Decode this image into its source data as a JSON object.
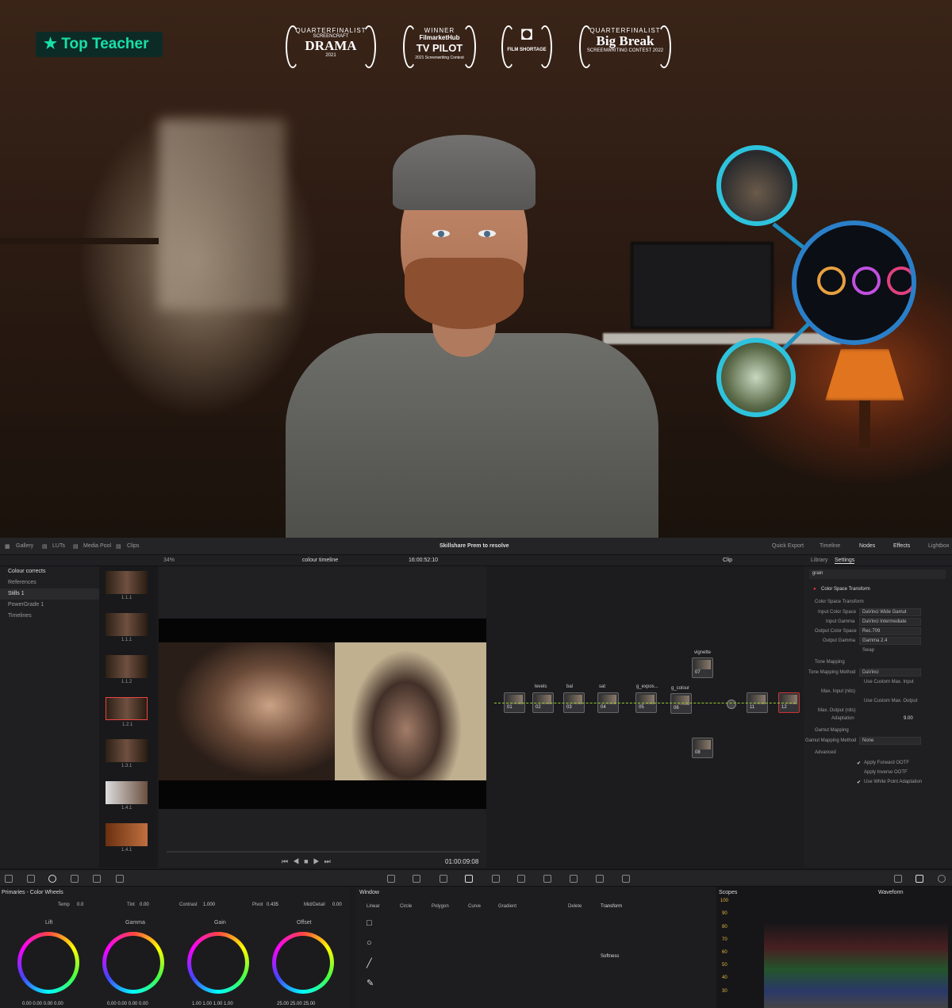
{
  "hero": {
    "badge": "★ Top Teacher",
    "laurels": [
      {
        "top": "QUARTERFINALIST",
        "mid": "SCREENCRAFT",
        "big": "DRAMA",
        "bottom": "2021"
      },
      {
        "top": "WINNER",
        "mid": "FilmarketHub",
        "big": "TV PILOT",
        "bottom": "2021 Screenwriting Contest"
      },
      {
        "top": "",
        "mid": "",
        "big": "◘",
        "bottom": "FILM SHORTAGE"
      },
      {
        "top": "QUARTERFINALIST",
        "mid": "",
        "big": "Big Break",
        "bottom": "SCREENWRITING CONTEST 2022"
      }
    ]
  },
  "topbar": {
    "gallery": "Gallery",
    "luts": "LUTs",
    "media_pool": "Media Pool",
    "clips": "Clips",
    "project": "Skillshare Prem to resolve",
    "quick_export": "Quick Export",
    "timeline": "Timeline",
    "nodes": "Nodes",
    "effects": "Effects",
    "lightbox": "Lightbox"
  },
  "subbar": {
    "zoom": "34%",
    "timeline_name": "colour timeline",
    "timecode": "16:00:52:10",
    "clip": "Clip",
    "library": "Library",
    "settings": "Settings"
  },
  "gallery": {
    "items": [
      "Colour corrects",
      "References",
      "Stills 1",
      "PowerGrade 1",
      "Timelines"
    ]
  },
  "thumbs": [
    "1.1.1",
    "1.1.1",
    "1.1.2",
    "1.2.1",
    "1.3.1",
    "1.4.1",
    "1.4.1"
  ],
  "viewer": {
    "timecode": "01:00:09:08"
  },
  "nodes": [
    {
      "num": "01",
      "label": ""
    },
    {
      "num": "02",
      "label": "levels"
    },
    {
      "num": "03",
      "label": "bal"
    },
    {
      "num": "04",
      "label": "sat"
    },
    {
      "num": "05",
      "label": "g_expos..."
    },
    {
      "num": "06",
      "label": "g_colour"
    },
    {
      "num": "07",
      "label": "vignette"
    },
    {
      "num": "08",
      "label": ""
    },
    {
      "num": "11",
      "label": ""
    },
    {
      "num": "12",
      "label": ""
    }
  ],
  "settings": {
    "search": "grain",
    "effect": "Color Space Transform",
    "section1": "Color Space Transform",
    "rows": [
      {
        "label": "Input Color Space",
        "value": "DaVinci Wide Gamut"
      },
      {
        "label": "Input Gamma",
        "value": "DaVinci Intermediate"
      },
      {
        "label": "Output Color Space",
        "value": "Rec.709"
      },
      {
        "label": "Output Gamma",
        "value": "Gamma 2.4"
      }
    ],
    "swap": "Swap",
    "tone_mapping": "Tone Mapping",
    "tone_method_label": "Tone Mapping Method",
    "tone_method": "DaVinci",
    "custom_max_input": "Use Custom Max. Input",
    "max_input": "Max. Input (nits)",
    "custom_max_output": "Use Custom Max. Output",
    "max_output": "Max. Output (nits)",
    "adaptation": "Adaptation",
    "adaptation_val": "9.00",
    "gamut_mapping": "Gamut Mapping",
    "gamut_method_label": "Gamut Mapping Method",
    "gamut_method": "None",
    "advanced": "Advanced",
    "apply_forward": "Apply Forward OOTF",
    "apply_inverse": "Apply Inverse OOTF",
    "white_point": "Use White Point Adaptation"
  },
  "wheels": {
    "title": "Primaries - Color Wheels",
    "temp_label": "Temp",
    "temp": "0.0",
    "tint_label": "Tint",
    "tint": "0.00",
    "contrast_label": "Contrast",
    "contrast": "1.000",
    "pivot_label": "Pivot",
    "pivot": "0.435",
    "mid_label": "Mid/Detail",
    "mid": "0.00",
    "names": [
      "Lift",
      "Gamma",
      "Gain",
      "Offset"
    ],
    "values": [
      "0.00  0.00  0.00  0.00",
      "0.00  0.00  0.00  0.00",
      "1.00  1.00  1.00  1.00",
      "25.00  25.00  25.00"
    ]
  },
  "window": {
    "title": "Window",
    "linear": "Linear",
    "circle": "Circle",
    "polygon": "Polygon",
    "curve": "Curve",
    "gradient": "Gradient",
    "delete": "Delete",
    "transform": "Transform",
    "softness": "Softness"
  },
  "scopes": {
    "title": "Scopes",
    "mode": "Waveform",
    "ticks": [
      "100",
      "90",
      "80",
      "70",
      "60",
      "50",
      "40",
      "30"
    ]
  }
}
